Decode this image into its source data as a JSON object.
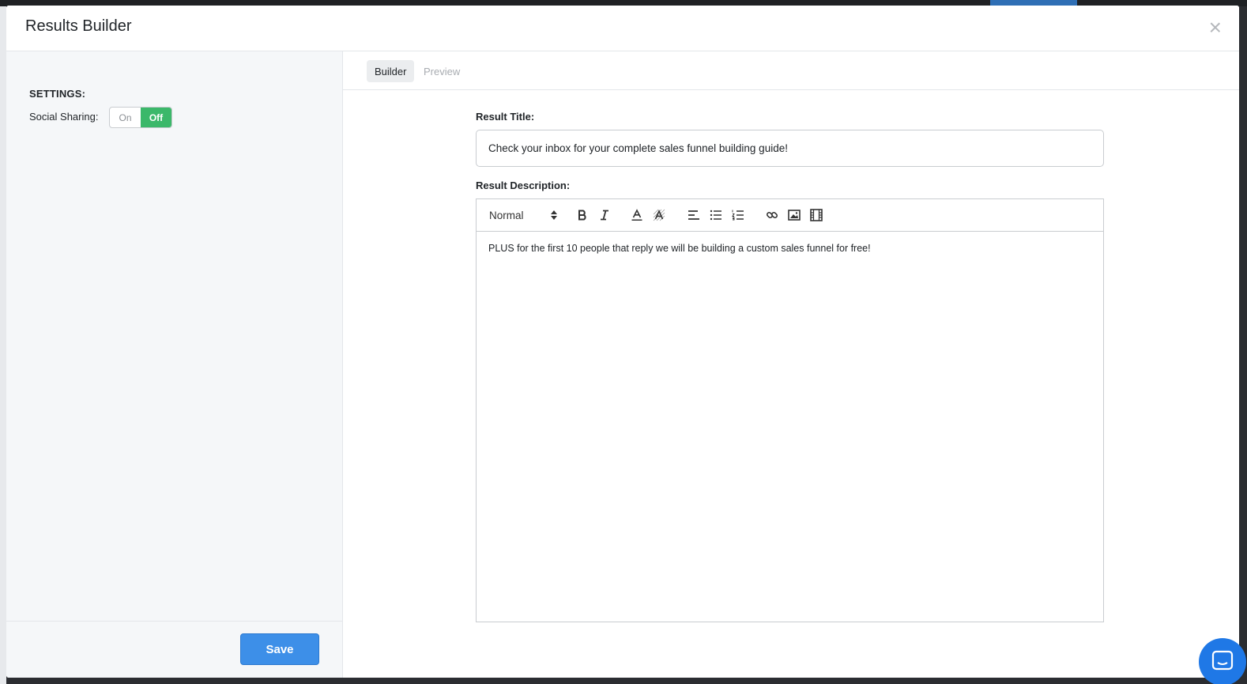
{
  "modal": {
    "title": "Results Builder",
    "close_glyph": "×"
  },
  "settings": {
    "heading": "SETTINGS:",
    "social_sharing_label": "Social Sharing:",
    "toggle_on_label": "On",
    "toggle_off_label": "Off",
    "selected": "Off"
  },
  "footer": {
    "save_label": "Save"
  },
  "tabs": [
    {
      "label": "Builder",
      "active": true
    },
    {
      "label": "Preview",
      "active": false
    }
  ],
  "result": {
    "title_label": "Result Title:",
    "title_value": "Check your inbox for your complete sales funnel building guide!",
    "description_label": "Result Description:",
    "description_text": "PLUS for the first 10 people that reply we will be building a custom sales funnel for free!"
  },
  "toolbar": {
    "format_value": "Normal",
    "icons": [
      "bold-icon",
      "italic-icon",
      "text-color-icon",
      "background-color-icon",
      "align-icon",
      "bullet-list-icon",
      "numbered-list-icon",
      "link-icon",
      "image-icon",
      "video-icon"
    ]
  },
  "colors": {
    "toggle_active": "#3bb86a",
    "save_button": "#3d8fe8",
    "chat_button": "#1f78e6"
  }
}
